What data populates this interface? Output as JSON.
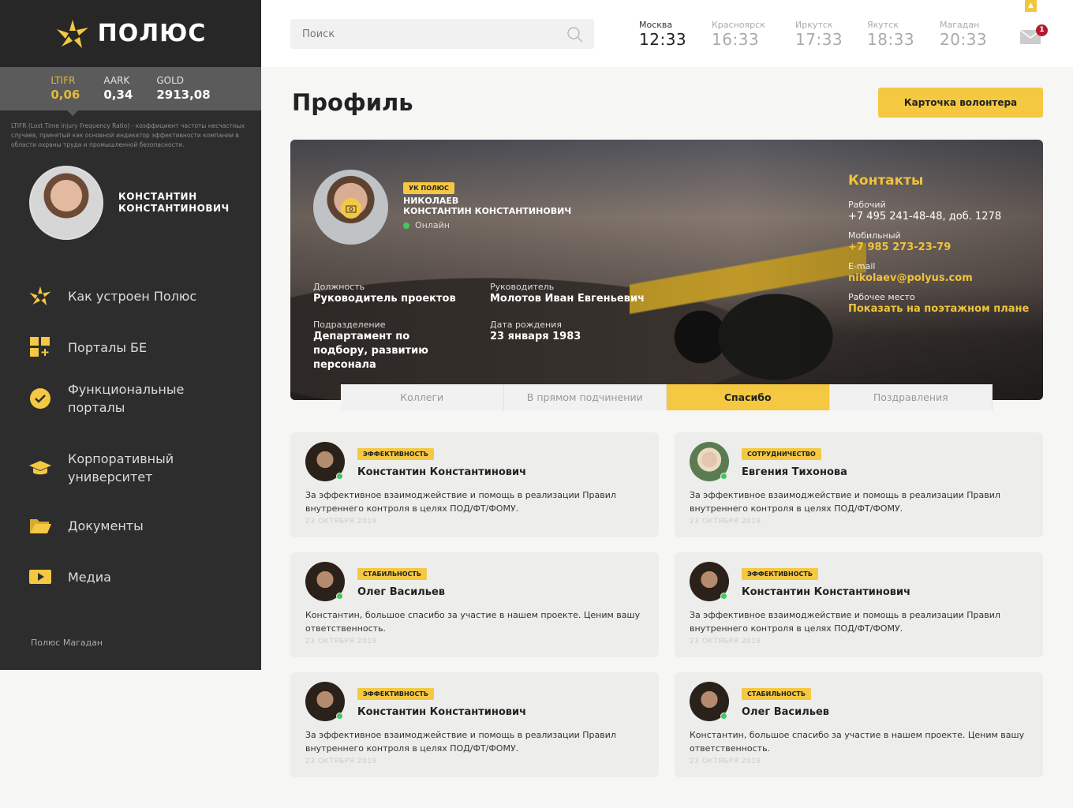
{
  "brand": {
    "name": "ПОЛЮС"
  },
  "stats": [
    {
      "label": "LTIFR",
      "value": "0,06"
    },
    {
      "label": "AARK",
      "value": "0,34"
    },
    {
      "label": "GOLD",
      "value": "2913,08"
    }
  ],
  "stats_description": "LTIFR (Lost Time injury Frequency Ratio) - коэффициент частоты несчастных случаев, принятый как основной индикатор эффективности компании в области охраны труда и промышленной безопасности.",
  "user": {
    "name_line1": "КОНСТАНТИН",
    "name_line2": "КОНСТАНТИНОВИЧ"
  },
  "nav": [
    {
      "label": "Как устроен Полюс",
      "icon": "polus-logo-icon"
    },
    {
      "label": "Порталы БЕ",
      "icon": "grid-plus-icon"
    },
    {
      "label": "Функциональные порталы",
      "icon": "check-circle-icon"
    },
    {
      "label": "Корпоративный университет",
      "icon": "graduation-cap-icon"
    },
    {
      "label": "Документы",
      "icon": "folder-icon"
    },
    {
      "label": "Медиа",
      "icon": "play-icon"
    }
  ],
  "region": "Полюс Магадан",
  "search": {
    "placeholder": "Поиск"
  },
  "clocks": [
    {
      "city": "Москва",
      "time": "12:33"
    },
    {
      "city": "Красноярск",
      "time": "16:33"
    },
    {
      "city": "Иркутск",
      "time": "17:33"
    },
    {
      "city": "Якутск",
      "time": "18:33"
    },
    {
      "city": "Магадан",
      "time": "20:33"
    }
  ],
  "notifications": {
    "count": "1"
  },
  "page": {
    "title": "Профиль",
    "volunteer_button": "Карточка волонтера"
  },
  "profile": {
    "company_tag": "УК ПОЛЮС",
    "surname": "НИКОЛАЕВ",
    "name": "КОНСТАНТИН КОНСТАНТИНОВИЧ",
    "status": "Онлайн",
    "fields": [
      {
        "label": "Должность",
        "value": "Руководитель проектов"
      },
      {
        "label": "Руководитель",
        "value": "Молотов Иван Евгеньевич"
      },
      {
        "label": "Подразделение",
        "value": "Департамент по подбору, развитию персонала"
      },
      {
        "label": "Дата рождения",
        "value": "23 января 1983"
      }
    ],
    "contacts": {
      "title": "Контакты",
      "work_label": "Рабочий",
      "work": "+7 495 241-48-48, доб. 1278",
      "mobile_label": "Мобильный",
      "mobile": "+7 985 273-23-79",
      "email_label": "E-mail",
      "email": "nikolaev@polyus.com",
      "place_label": "Рабочее место",
      "place": "Показать на поэтажном плане"
    }
  },
  "tabs": [
    {
      "label": "Коллеги"
    },
    {
      "label": "В прямом подчинении"
    },
    {
      "label": "Спасибо",
      "active": true
    },
    {
      "label": "Поздравления"
    }
  ],
  "thanks": [
    {
      "tag": "ЭФФЕКТИВНОСТЬ",
      "name": "Константин Константинович",
      "text": "За эффективное взаимоджействие и помощь в реализации Правил внутреннего контроля в целях ПОД/ФТ/ФОМУ.",
      "date": "23 ОКТЯБРЯ 2019"
    },
    {
      "tag": "СОТРУДНИЧЕСТВО",
      "name": "Евгения Тихонова",
      "text": "За эффективное взаимоджействие и помощь в реализации Правил внутреннего контроля в целях ПОД/ФТ/ФОМУ.",
      "date": "23 ОКТЯБРЯ 2019"
    },
    {
      "tag": "СТАБИЛЬНОСТЬ",
      "name": "Олег Васильев",
      "text": "Константин, большое спасибо за участие в нашем проекте. Ценим вашу ответственность.",
      "date": "23 ОКТЯБРЯ 2019"
    },
    {
      "tag": "ЭФФЕКТИВНОСТЬ",
      "name": "Константин Константинович",
      "text": "За эффективное взаимоджействие и помощь в реализации Правил внутреннего контроля в целях ПОД/ФТ/ФОМУ.",
      "date": "23 ОКТЯБРЯ 2019"
    },
    {
      "tag": "ЭФФЕКТИВНОСТЬ",
      "name": "Константин Константинович",
      "text": "За эффективное взаимоджействие и помощь в реализации Правил внутреннего контроля в целях ПОД/ФТ/ФОМУ.",
      "date": "23 ОКТЯБРЯ 2019"
    },
    {
      "tag": "СТАБИЛЬНОСТЬ",
      "name": "Олег Васильев",
      "text": "Константин, большое спасибо за участие в нашем проекте. Ценим вашу ответственность.",
      "date": "23 ОКТЯБРЯ 2019"
    }
  ],
  "colors": {
    "accent": "#f5c842",
    "sidebar": "#2d2d2d",
    "online": "#3fca5a",
    "badge": "#b01c2e"
  }
}
